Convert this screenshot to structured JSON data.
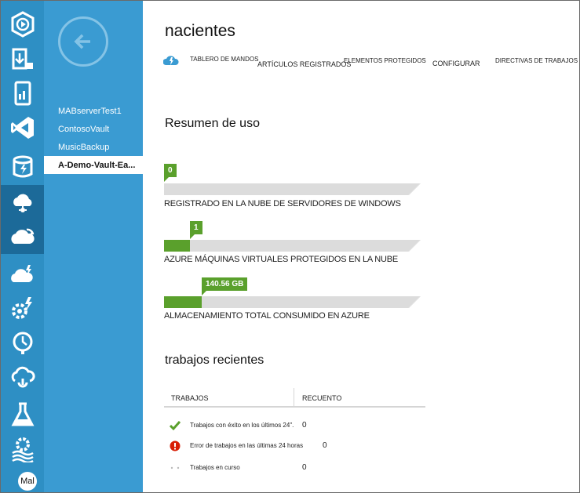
{
  "rail": {
    "items": [
      {
        "icon": "media-services-icon",
        "active": false
      },
      {
        "icon": "data-import-icon",
        "active": false
      },
      {
        "icon": "mobile-services-icon",
        "active": false
      },
      {
        "icon": "visual-studio-icon",
        "active": false
      },
      {
        "icon": "cache-icon",
        "active": false
      },
      {
        "icon": "hdinsight-icon",
        "active": false
      },
      {
        "icon": "recovery-services-icon",
        "active": true
      },
      {
        "icon": "store-icon",
        "active": false
      },
      {
        "icon": "automation-icon",
        "active": false
      },
      {
        "icon": "scheduler-icon",
        "active": false
      },
      {
        "icon": "api-management-icon",
        "active": false
      },
      {
        "icon": "machine-learning-icon",
        "active": false
      },
      {
        "icon": "settings-icon",
        "active": false
      },
      {
        "icon": "stream-analytics-icon",
        "active": false
      }
    ],
    "user_label": "Mal"
  },
  "subnav": {
    "vaults": [
      "MABserverTest1",
      "ContosoVault",
      "MusicBackup",
      "A-Demo-Vault-Ea..."
    ],
    "selected_index": 3
  },
  "page": {
    "title": "nacientes",
    "tabs": [
      {
        "label": "TABLERO DE MANDOS"
      },
      {
        "label": "ARTÍCULOS REGISTRADOS"
      },
      {
        "label": "ELEMENTOS PROTEGIDOS"
      },
      {
        "label": "CONFIGURAR"
      },
      {
        "label": "DIRECTIVAS DE TRABAJOS"
      }
    ]
  },
  "usage": {
    "title": "Resumen de uso",
    "bars": [
      {
        "value_label": "0",
        "fill_fraction": 0.0,
        "label": "REGISTRADO EN LA NUBE DE SERVIDORES DE WINDOWS"
      },
      {
        "value_label": "1",
        "fill_fraction": 0.1,
        "label": "AZURE MÁQUINAS VIRTUALES PROTEGIDOS EN LA NUBE"
      },
      {
        "value_label": "140.56 GB",
        "fill_fraction": 0.145,
        "label": "ALMACENAMIENTO TOTAL CONSUMIDO EN AZURE"
      }
    ],
    "fill_color": "#5aa02c"
  },
  "recent_jobs": {
    "title": "trabajos recientes",
    "columns": [
      "TRABAJOS",
      "RECUENTO"
    ],
    "rows": [
      {
        "status_icon": "success-check-icon",
        "text": "Trabajos con éxito en los últimos 24\".",
        "count": "0"
      },
      {
        "status_icon": "error-icon",
        "text": "Error de trabajos en las últimas 24 horas",
        "count": "0"
      },
      {
        "status_icon": "in-progress-icon",
        "text": "Trabajos en curso",
        "count": "0"
      }
    ]
  },
  "colors": {
    "rail": "#2e8fc4",
    "subnav": "#3a9bd2",
    "accent_green": "#5aa02c",
    "error_red": "#d81e05"
  }
}
